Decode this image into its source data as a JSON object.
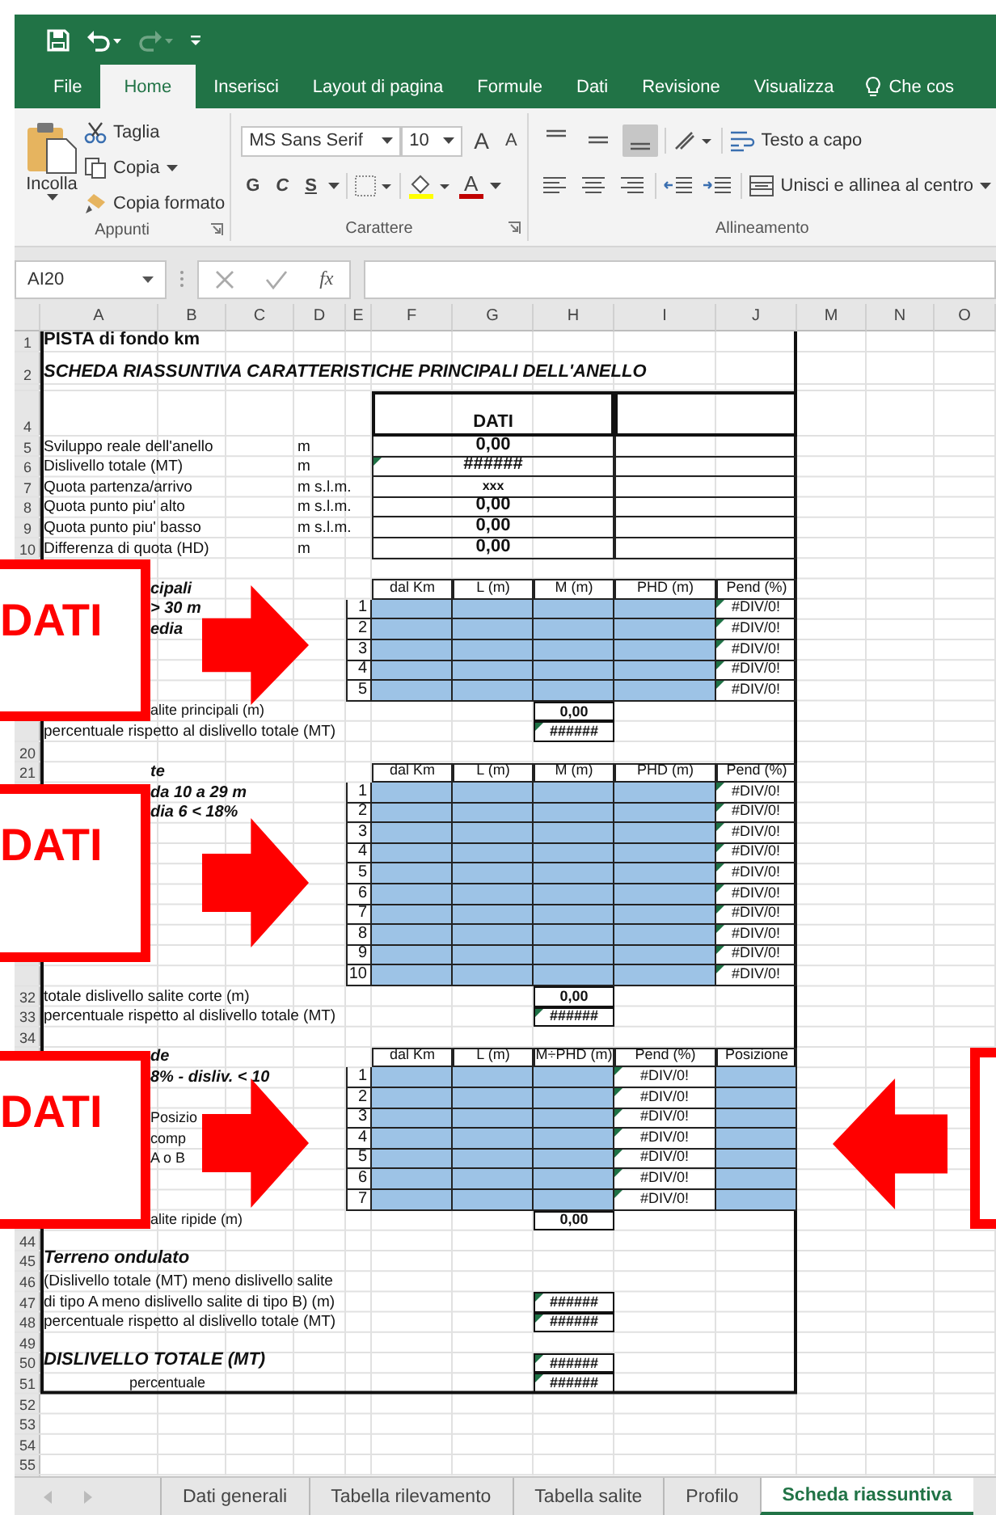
{
  "quick_access": [
    {
      "kind": "save",
      "disabled": false
    },
    {
      "kind": "undo",
      "disabled": false
    },
    {
      "kind": "redo",
      "disabled": true
    },
    {
      "kind": "customize",
      "disabled": false
    }
  ],
  "ribbon_tabs": [
    {
      "label": "File",
      "kind": "tab",
      "selected": false
    },
    {
      "label": "Home",
      "kind": "tab",
      "selected": true
    },
    {
      "label": "Inserisci",
      "kind": "tab",
      "selected": false
    },
    {
      "label": "Layout di pagina",
      "kind": "tab",
      "selected": false
    },
    {
      "label": "Formule",
      "kind": "tab",
      "selected": false
    },
    {
      "label": "Dati",
      "kind": "tab",
      "selected": false
    },
    {
      "label": "Revisione",
      "kind": "tab",
      "selected": false
    },
    {
      "label": "Visualizza",
      "kind": "tab",
      "selected": false
    },
    {
      "label": "Che cos",
      "kind": "tell",
      "selected": false
    }
  ],
  "ribbon": {
    "clipboard": {
      "paste": "Incolla",
      "cut": "Taglia",
      "copy": "Copia",
      "format_painter": "Copia formato",
      "label": "Appunti"
    },
    "font": {
      "family": "MS Sans Serif",
      "size": "10",
      "grow": "A",
      "shrink": "A",
      "styles": [
        {
          "kind": "bold",
          "label": "G"
        },
        {
          "kind": "italic",
          "label": "C"
        },
        {
          "kind": "underline",
          "label": "S"
        }
      ],
      "color_label": "A",
      "label": "Carattere"
    },
    "alignment": {
      "vertical": [
        {
          "selected": false
        },
        {
          "selected": false
        },
        {
          "selected": true
        }
      ],
      "wrap": "Testo a capo",
      "merge": "Unisci e allinea al centro",
      "label": "Allineamento"
    }
  },
  "formula_bar": {
    "name_box": "AI20",
    "function_label": "fx"
  },
  "column_headers": [
    "A",
    "B",
    "C",
    "D",
    "E",
    "F",
    "G",
    "H",
    "I",
    "J",
    "M",
    "N",
    "O"
  ],
  "row_headers": [
    "1",
    "2",
    "4",
    "5",
    "6",
    "7",
    "8",
    "9",
    "10",
    "20",
    "21",
    "32",
    "33",
    "34",
    "44",
    "45",
    "46",
    "47",
    "48",
    "49",
    "50",
    "51",
    "52",
    "53",
    "54",
    "55"
  ],
  "title": "PISTA di fondo  km",
  "subtitle": "SCHEDA RIASSUNTIVA CARATTERISTICHE PRINCIPALI DELL'ANELLO",
  "summary": {
    "header": "DATI",
    "rows": [
      {
        "label": "Sviluppo reale dell'anello",
        "unit": "m",
        "value": "0,00",
        "kind": "number",
        "flagged": false
      },
      {
        "label": "Dislivello totale (MT)",
        "unit": "m",
        "value": "######",
        "kind": "number",
        "flagged": true
      },
      {
        "label": "Quota partenza/arrivo",
        "unit": "m s.l.m.",
        "value": "xxx",
        "kind": "placeholder",
        "flagged": false
      },
      {
        "label": "Quota punto piu' alto",
        "unit": "m s.l.m.",
        "value": "0,00",
        "kind": "number",
        "flagged": false
      },
      {
        "label": "Quota punto piu' basso",
        "unit": "m s.l.m.",
        "value": "0,00",
        "kind": "number",
        "flagged": false
      },
      {
        "label": "Differenza di quota (HD)",
        "unit": "m",
        "value": "0,00",
        "kind": "number",
        "flagged": false
      }
    ]
  },
  "sections": [
    {
      "side": {
        "kind": "heading",
        "text": "cipali"
      },
      "columns": [
        "dal Km",
        "L (m)",
        "M (m)",
        "PHD (m)",
        "Pend (%)"
      ],
      "rows": [
        {
          "side": {
            "kind": "heading",
            "text": "> 30 m"
          },
          "index": "1",
          "cells": [
            {
              "kind": "input"
            },
            {
              "kind": "input"
            },
            {
              "kind": "input"
            },
            {
              "kind": "input"
            },
            {
              "kind": "error",
              "text": "#DIV/0!",
              "flagged": true
            }
          ]
        },
        {
          "side": {
            "kind": "heading",
            "text": "edia"
          },
          "index": "2",
          "cells": [
            {
              "kind": "input"
            },
            {
              "kind": "input"
            },
            {
              "kind": "input"
            },
            {
              "kind": "input"
            },
            {
              "kind": "error",
              "text": "#DIV/0!",
              "flagged": true
            }
          ]
        },
        {
          "index": "3",
          "cells": [
            {
              "kind": "input"
            },
            {
              "kind": "input"
            },
            {
              "kind": "input"
            },
            {
              "kind": "input"
            },
            {
              "kind": "error",
              "text": "#DIV/0!",
              "flagged": true
            }
          ]
        },
        {
          "index": "4",
          "cells": [
            {
              "kind": "input"
            },
            {
              "kind": "input"
            },
            {
              "kind": "input"
            },
            {
              "kind": "input"
            },
            {
              "kind": "error",
              "text": "#DIV/0!",
              "flagged": true
            }
          ]
        },
        {
          "index": "5",
          "cells": [
            {
              "kind": "input"
            },
            {
              "kind": "input"
            },
            {
              "kind": "input"
            },
            {
              "kind": "input"
            },
            {
              "kind": "error",
              "text": "#DIV/0!",
              "flagged": true
            }
          ]
        }
      ],
      "totals": [
        {
          "kind": "clipped",
          "label": "alite principali (m)",
          "value": "0,00",
          "flagged": false
        },
        {
          "kind": "full",
          "label": "percentuale rispetto al dislivello totale (MT)",
          "value": "######",
          "flagged": true
        }
      ]
    },
    {
      "side": {
        "kind": "heading",
        "text": "te"
      },
      "columns": [
        "dal Km",
        "L (m)",
        "M (m)",
        "PHD (m)",
        "Pend (%)"
      ],
      "rows": [
        {
          "side": {
            "kind": "heading",
            "text": "da 10 a 29 m"
          },
          "index": "1",
          "cells": [
            {
              "kind": "input"
            },
            {
              "kind": "input"
            },
            {
              "kind": "input"
            },
            {
              "kind": "input"
            },
            {
              "kind": "error",
              "text": "#DIV/0!",
              "flagged": true
            }
          ]
        },
        {
          "side": {
            "kind": "heading",
            "text": "dia 6 < 18%"
          },
          "index": "2",
          "cells": [
            {
              "kind": "input"
            },
            {
              "kind": "input"
            },
            {
              "kind": "input"
            },
            {
              "kind": "input"
            },
            {
              "kind": "error",
              "text": "#DIV/0!",
              "flagged": true
            }
          ]
        },
        {
          "index": "3",
          "cells": [
            {
              "kind": "input"
            },
            {
              "kind": "input"
            },
            {
              "kind": "input"
            },
            {
              "kind": "input"
            },
            {
              "kind": "error",
              "text": "#DIV/0!",
              "flagged": true
            }
          ]
        },
        {
          "index": "4",
          "cells": [
            {
              "kind": "input"
            },
            {
              "kind": "input"
            },
            {
              "kind": "input"
            },
            {
              "kind": "input"
            },
            {
              "kind": "error",
              "text": "#DIV/0!",
              "flagged": true
            }
          ]
        },
        {
          "index": "5",
          "cells": [
            {
              "kind": "input"
            },
            {
              "kind": "input"
            },
            {
              "kind": "input"
            },
            {
              "kind": "input"
            },
            {
              "kind": "error",
              "text": "#DIV/0!",
              "flagged": true
            }
          ]
        },
        {
          "index": "6",
          "cells": [
            {
              "kind": "input"
            },
            {
              "kind": "input"
            },
            {
              "kind": "input"
            },
            {
              "kind": "input"
            },
            {
              "kind": "error",
              "text": "#DIV/0!",
              "flagged": true
            }
          ]
        },
        {
          "index": "7",
          "cells": [
            {
              "kind": "input"
            },
            {
              "kind": "input"
            },
            {
              "kind": "input"
            },
            {
              "kind": "input"
            },
            {
              "kind": "error",
              "text": "#DIV/0!",
              "flagged": true
            }
          ]
        },
        {
          "index": "8",
          "cells": [
            {
              "kind": "input"
            },
            {
              "kind": "input"
            },
            {
              "kind": "input"
            },
            {
              "kind": "input"
            },
            {
              "kind": "error",
              "text": "#DIV/0!",
              "flagged": true
            }
          ]
        },
        {
          "index": "9",
          "cells": [
            {
              "kind": "input"
            },
            {
              "kind": "input"
            },
            {
              "kind": "input"
            },
            {
              "kind": "input"
            },
            {
              "kind": "error",
              "text": "#DIV/0!",
              "flagged": true
            }
          ]
        },
        {
          "index": "10",
          "cells": [
            {
              "kind": "input"
            },
            {
              "kind": "input"
            },
            {
              "kind": "input"
            },
            {
              "kind": "input"
            },
            {
              "kind": "error",
              "text": "#DIV/0!",
              "flagged": true
            }
          ]
        }
      ],
      "totals": [
        {
          "kind": "full",
          "label": "totale dislivello salite corte (m)",
          "value": "0,00",
          "flagged": false
        },
        {
          "kind": "full",
          "label": "percentuale rispetto al dislivello totale (MT)",
          "value": "######",
          "flagged": true
        }
      ]
    },
    {
      "side": {
        "kind": "heading",
        "text": "de"
      },
      "columns": [
        "dal Km",
        "L (m)",
        "M÷PHD (m)",
        "Pend (%)",
        "Posizione"
      ],
      "rows": [
        {
          "side": {
            "kind": "heading",
            "text": "8% - disliv. < 10"
          },
          "index": "1",
          "cells": [
            {
              "kind": "input"
            },
            {
              "kind": "input"
            },
            {
              "kind": "input"
            },
            {
              "kind": "error",
              "text": "#DIV/0!",
              "flagged": true
            },
            {
              "kind": "input"
            }
          ]
        },
        {
          "index": "2",
          "cells": [
            {
              "kind": "input"
            },
            {
              "kind": "input"
            },
            {
              "kind": "input"
            },
            {
              "kind": "error",
              "text": "#DIV/0!",
              "flagged": true
            },
            {
              "kind": "input"
            }
          ]
        },
        {
          "side": {
            "kind": "text",
            "text": "Posizio"
          },
          "index": "3",
          "cells": [
            {
              "kind": "input"
            },
            {
              "kind": "input"
            },
            {
              "kind": "input"
            },
            {
              "kind": "error",
              "text": "#DIV/0!",
              "flagged": true
            },
            {
              "kind": "input"
            }
          ]
        },
        {
          "side": {
            "kind": "text",
            "text": "comp"
          },
          "index": "4",
          "cells": [
            {
              "kind": "input"
            },
            {
              "kind": "input"
            },
            {
              "kind": "input"
            },
            {
              "kind": "error",
              "text": "#DIV/0!",
              "flagged": true
            },
            {
              "kind": "input"
            }
          ]
        },
        {
          "side": {
            "kind": "text",
            "text": "A o B"
          },
          "index": "5",
          "cells": [
            {
              "kind": "input"
            },
            {
              "kind": "input"
            },
            {
              "kind": "input"
            },
            {
              "kind": "error",
              "text": "#DIV/0!",
              "flagged": true
            },
            {
              "kind": "input"
            }
          ]
        },
        {
          "index": "6",
          "cells": [
            {
              "kind": "input"
            },
            {
              "kind": "input"
            },
            {
              "kind": "input"
            },
            {
              "kind": "error",
              "text": "#DIV/0!",
              "flagged": true
            },
            {
              "kind": "input"
            }
          ]
        },
        {
          "index": "7",
          "cells": [
            {
              "kind": "input"
            },
            {
              "kind": "input"
            },
            {
              "kind": "input"
            },
            {
              "kind": "error",
              "text": "#DIV/0!",
              "flagged": true
            },
            {
              "kind": "input"
            }
          ]
        }
      ],
      "totals": [
        {
          "kind": "clipped",
          "label": "alite ripide (m)",
          "value": "0,00",
          "flagged": false
        }
      ]
    }
  ],
  "undulating": {
    "title": "Terreno ondulato",
    "lines": [
      {
        "label": "(Dislivello totale (MT) meno dislivello salite"
      },
      {
        "label": "di tipo A meno dislivello salite di tipo B) (m)",
        "value": "######",
        "flagged": true
      },
      {
        "label": "percentuale rispetto al dislivello totale (MT)",
        "value": "######",
        "flagged": true
      }
    ]
  },
  "overall": {
    "title": "DISLIVELLO TOTALE (MT)",
    "value": "######",
    "flagged": true,
    "percent_label": "percentuale",
    "percent_value": "######",
    "percent_flagged": true
  },
  "callouts": [
    {
      "kind": "box",
      "text": "DATI"
    },
    {
      "kind": "box",
      "text": "DATI"
    },
    {
      "kind": "box",
      "text": "DATI"
    },
    {
      "kind": "box"
    }
  ],
  "arrows": [
    {
      "kind": "right"
    },
    {
      "kind": "right"
    },
    {
      "kind": "right"
    },
    {
      "kind": "left"
    }
  ],
  "sheet_tabs": [
    {
      "label": "Dati generali",
      "selected": false
    },
    {
      "label": "Tabella rilevamento",
      "selected": false
    },
    {
      "label": "Tabella salite",
      "selected": false
    },
    {
      "label": "Profilo",
      "selected": false
    },
    {
      "label": "Scheda riassuntiva",
      "selected": true
    }
  ]
}
